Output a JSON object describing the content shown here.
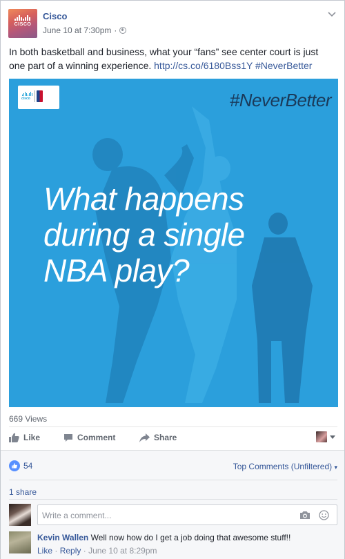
{
  "post": {
    "page_name": "Cisco",
    "date": "June 10 at 7:30pm",
    "separator": "·",
    "text_before_link": "In both basketball and business, what your “fans” see center court is just one part of a winning experience.",
    "link": "http://cs.co/6180Bss1Y",
    "hashtag_link": "#NeverBetter"
  },
  "logo": {
    "word": "CISCO"
  },
  "video": {
    "hashtag": "#NeverBetter",
    "headline_lines": [
      "What happens",
      "during a single",
      "NBA play?"
    ],
    "badge_word": "cisco",
    "bg_color": "#2b9fdc"
  },
  "stats": {
    "views": "669 Views"
  },
  "actions": {
    "like": "Like",
    "comment": "Comment",
    "share": "Share"
  },
  "reactions": {
    "like_count": "54",
    "sort_label": "Top Comments (Unfiltered)",
    "sort_caret": "▾",
    "shares": "1 share"
  },
  "composer": {
    "placeholder": "Write a comment..."
  },
  "comment": {
    "author": "Kevin Wallen",
    "body": "Well now how do I get a job doing that awesome stuff!!",
    "like": "Like",
    "reply": "Reply",
    "time": "June 10 at 8:29pm",
    "sep": "·"
  },
  "colors": {
    "link": "#365899",
    "accent_like": "#5890ff"
  }
}
